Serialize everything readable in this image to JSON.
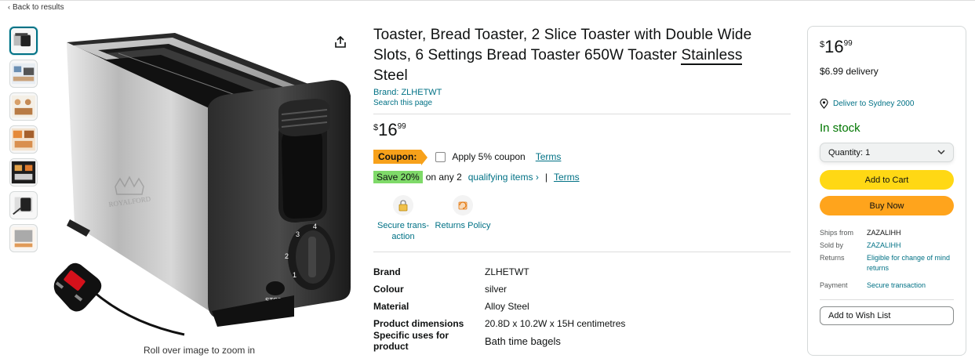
{
  "nav": {
    "back_label": "Back to results"
  },
  "image": {
    "zoom_hint": "Roll over image to zoom in",
    "brand_embossed": "ROYALFORD"
  },
  "product": {
    "title_main": "Toaster, Bread Toaster, 2 Slice Toaster with Double Wide Slots, 6 Settings Bread Toaster  650W Toaster ",
    "title_underlined": "Stainless",
    "title_end": "Steel",
    "brand_link": "Brand: ZLHETWT",
    "search_link": "Search this page",
    "price": {
      "symbol": "$",
      "whole": "16",
      "fraction": "99"
    },
    "coupon": {
      "badge": "Coupon:",
      "label": "Apply 5% coupon",
      "terms": "Terms"
    },
    "promo": {
      "badge": "Save 20%",
      "text": "on any 2",
      "link": "qualifying items",
      "arrow": "›",
      "separator": "|",
      "terms": "Terms"
    },
    "badges": [
      {
        "icon": "lock-icon",
        "label": "Secure trans-\naction"
      },
      {
        "icon": "returns-icon",
        "label": "Returns Policy"
      }
    ],
    "specs": [
      {
        "key": "Brand",
        "value": "ZLHETWT"
      },
      {
        "key": "Colour",
        "value": "silver"
      },
      {
        "key": "Material",
        "value": "Alloy Steel"
      },
      {
        "key": "Product dimensions",
        "value": "20.8D x 10.2W x 15H centimetres"
      },
      {
        "key": "Specific uses for product",
        "value": "Bath time bagels"
      }
    ]
  },
  "buybox": {
    "price": {
      "symbol": "$",
      "whole": "16",
      "fraction": "99"
    },
    "delivery": "$6.99 delivery",
    "location": "Deliver to Sydney 2000",
    "stock": "In stock",
    "quantity": "Quantity: 1",
    "add_to_cart": "Add to Cart",
    "buy_now": "Buy Now",
    "ships_from_label": "Ships from",
    "ships_from": "ZAZALIHH",
    "sold_by_label": "Sold by",
    "sold_by": "ZAZALIHH",
    "returns_label": "Returns",
    "returns": "Eligible for change of mind returns",
    "payment_label": "Payment",
    "payment": "Secure transaction",
    "wish_list": "Add to Wish List"
  },
  "colors": {
    "link": "#007185",
    "cart": "#ffd814",
    "buy": "#ffa41c",
    "stock": "#007600",
    "coupon": "#f7a11a",
    "save": "#7fda69"
  }
}
